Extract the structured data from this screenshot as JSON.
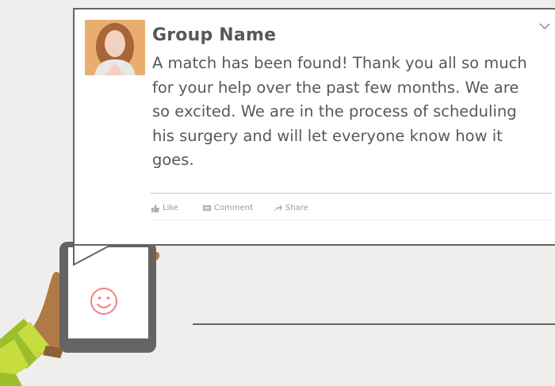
{
  "post": {
    "group_name": "Group Name",
    "body": "A match has been found! Thank you all so much for your help over the past few months. We are so excited. We are in the process of scheduling his surgery and will let everyone know how it goes.",
    "actions": {
      "like": "Like",
      "comment": "Comment",
      "share": "Share"
    }
  },
  "icons": [
    "avatar",
    "chevron-down-icon",
    "like-icon",
    "comment-icon",
    "share-icon",
    "smiley-icon"
  ],
  "colors": {
    "background": "#efeeed",
    "text": "#55595c",
    "outline": "#646464",
    "smiley": "#f08080",
    "skin": "#b07a47",
    "sleeve_lime": "#c7dc3e",
    "sleeve_green": "#9bbf2c"
  }
}
